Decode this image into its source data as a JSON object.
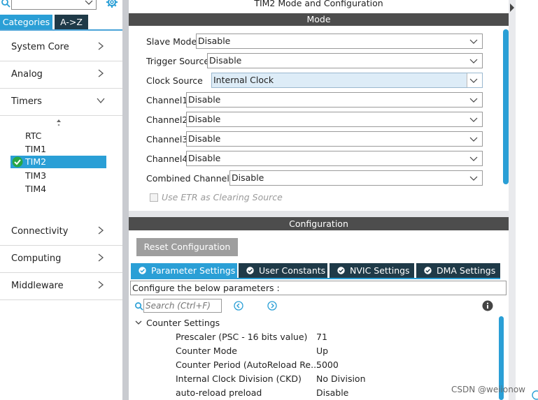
{
  "window_title": "TIM2 Mode and Configuration",
  "sidebar": {
    "search": {
      "value": "",
      "placeholder": ""
    },
    "tabs": [
      "Categories",
      "A->Z"
    ],
    "categories": [
      "System Core",
      "Analog",
      "Timers",
      "Connectivity",
      "Computing",
      "Middleware"
    ],
    "timers": [
      "RTC",
      "TIM1",
      "TIM2",
      "TIM3",
      "TIM4"
    ],
    "selected_timer": "TIM2"
  },
  "mode": {
    "header": "Mode",
    "fields": [
      {
        "label": "Slave Mode",
        "value": "Disable"
      },
      {
        "label": "Trigger Source",
        "value": "Disable"
      },
      {
        "label": "Clock Source",
        "value": "Internal Clock"
      },
      {
        "label": "Channel1",
        "value": "Disable"
      },
      {
        "label": "Channel2",
        "value": "Disable"
      },
      {
        "label": "Channel3",
        "value": "Disable"
      },
      {
        "label": "Channel4",
        "value": "Disable"
      },
      {
        "label": "Combined Channels",
        "value": "Disable"
      }
    ],
    "etr_checkbox_label": "Use ETR as Clearing Source"
  },
  "configuration": {
    "header": "Configuration",
    "reset_button": "Reset Configuration",
    "tabs": [
      "Parameter Settings",
      "User Constants",
      "NVIC Settings",
      "DMA Settings"
    ],
    "info_text": "Configure the below parameters :",
    "search_placeholder": "Search (Ctrl+F)",
    "group_title": "Counter Settings",
    "params": [
      {
        "name": "Prescaler (PSC - 16 bits value)",
        "value": "71"
      },
      {
        "name": "Counter Mode",
        "value": "Up"
      },
      {
        "name": "Counter Period (AutoReload Re...",
        "value": "5000"
      },
      {
        "name": "Internal Clock Division (CKD)",
        "value": "No Division"
      },
      {
        "name": "auto-reload preload",
        "value": "Disable"
      }
    ]
  },
  "watermark": "CSDN @weiionow",
  "colors": {
    "accent": "#2a9fd6",
    "header_dark": "#4d4d4d",
    "tab_dark": "#1f3a48",
    "highlight": "#ddecf7",
    "check_green": "#28a745"
  }
}
